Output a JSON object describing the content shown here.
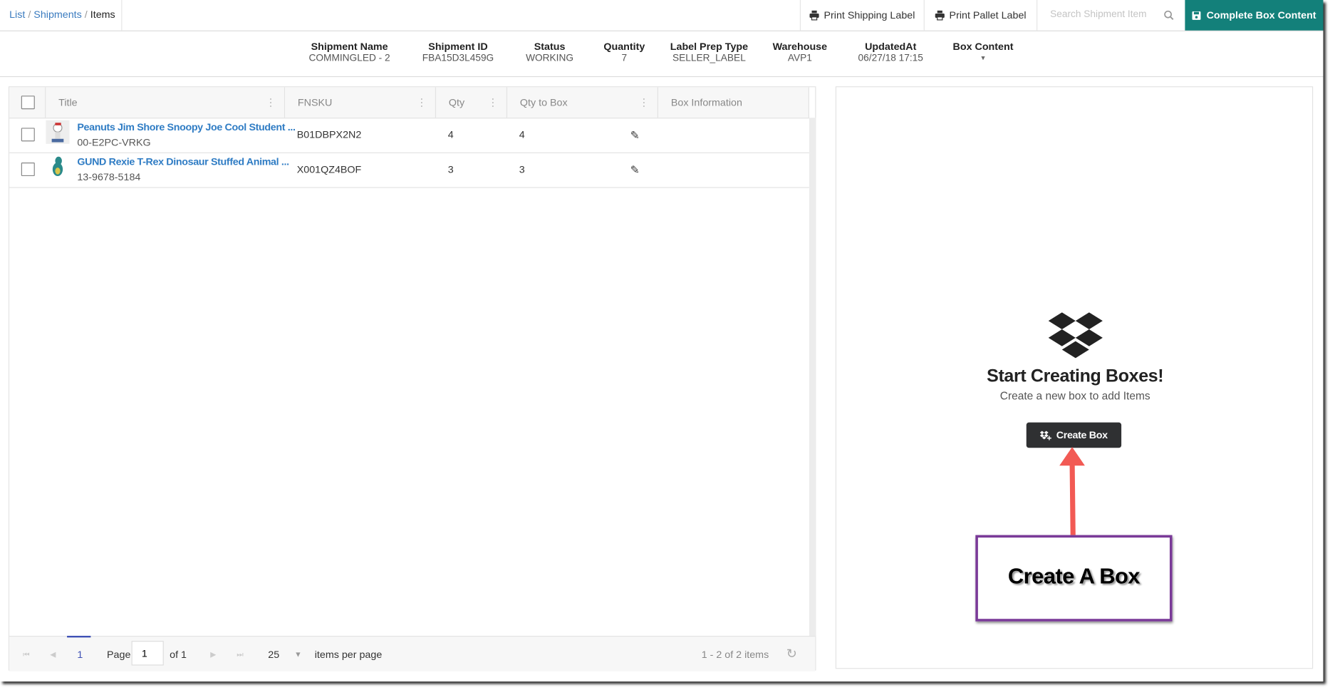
{
  "breadcrumb": {
    "items": [
      "List",
      "Shipments",
      "Items"
    ],
    "separator": "/"
  },
  "toolbar": {
    "print_shipping_label": "Print Shipping Label",
    "print_pallet_label": "Print Pallet Label",
    "search_placeholder": "Search Shipment Item",
    "complete_box_content": "Complete Box Content",
    "accent_color": "#13807a"
  },
  "meta": [
    {
      "label": "Shipment Name",
      "value": "COMMINGLED - 2"
    },
    {
      "label": "Shipment ID",
      "value": "FBA15D3L459G"
    },
    {
      "label": "Status",
      "value": "WORKING"
    },
    {
      "label": "Quantity",
      "value": "7"
    },
    {
      "label": "Label Prep Type",
      "value": "SELLER_LABEL"
    },
    {
      "label": "Warehouse",
      "value": "AVP1"
    },
    {
      "label": "UpdatedAt",
      "value": "06/27/18 17:15"
    },
    {
      "label": "Box Content",
      "value": "▾"
    }
  ],
  "grid": {
    "columns": [
      "Title",
      "FNSKU",
      "Qty",
      "Qty to Box",
      "Box Information"
    ],
    "rows": [
      {
        "title": "Peanuts Jim Shore Snoopy Joe Cool Student ...",
        "sku": "00-E2PC-VRKG",
        "fnsku": "B01DBPX2N2",
        "qty": "4",
        "qty_to_box": "4",
        "box_info": ""
      },
      {
        "title": "GUND Rexie T-Rex Dinosaur Stuffed Animal ...",
        "sku": "13-9678-5184",
        "fnsku": "X001QZ4BOF",
        "qty": "3",
        "qty_to_box": "3",
        "box_info": ""
      }
    ]
  },
  "pager": {
    "current_page": "1",
    "page_label": "Page",
    "page_input": "1",
    "of_label": "of 1",
    "page_size": "25",
    "per_page_label": "items per page",
    "summary": "1 - 2 of 2 items"
  },
  "boxes_panel": {
    "title": "Start Creating Boxes!",
    "subtitle": "Create a new box to add Items",
    "create_button": "Create Box"
  },
  "annotation": {
    "text": "Create A Box",
    "arrow_color": "#f25a54",
    "box_color": "#7a3a98"
  }
}
